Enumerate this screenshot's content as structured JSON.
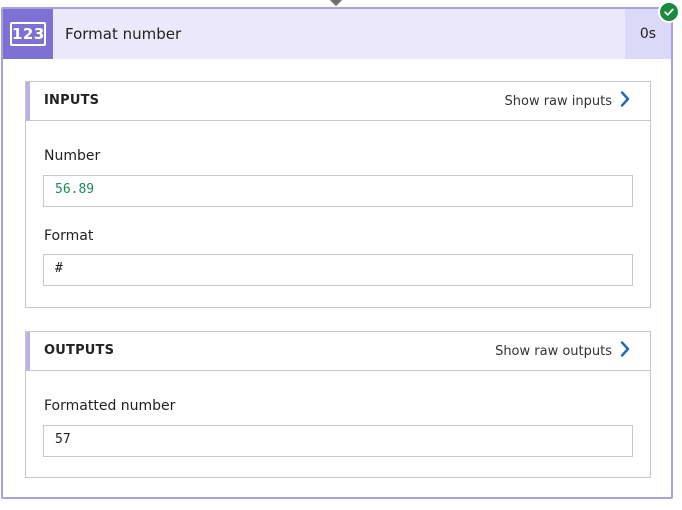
{
  "action": {
    "icon_text": "123",
    "title": "Format number",
    "duration": "0s",
    "status_icon": "check-circle-icon",
    "accent_color": "#7d72d4",
    "status_color": "#1b8a3e"
  },
  "inputs": {
    "title": "INPUTS",
    "show_raw_label": "Show raw inputs",
    "fields": {
      "number": {
        "label": "Number",
        "value": "56.89"
      },
      "format": {
        "label": "Format",
        "value": "#"
      }
    }
  },
  "outputs": {
    "title": "OUTPUTS",
    "show_raw_label": "Show raw outputs",
    "fields": {
      "formatted_number": {
        "label": "Formatted number",
        "value": "57"
      }
    }
  }
}
